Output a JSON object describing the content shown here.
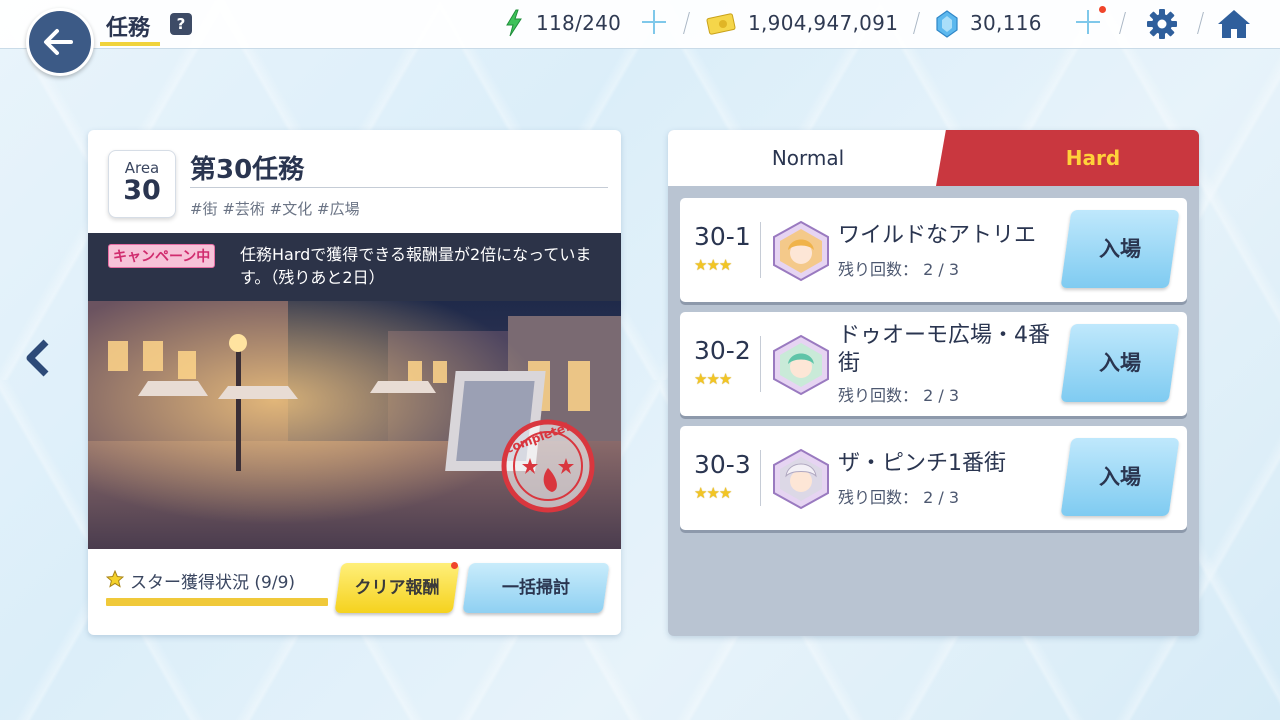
{
  "header": {
    "title": "任務",
    "help": "?",
    "stamina": "118/240",
    "money": "1,904,947,091",
    "gems": "30,116"
  },
  "mission": {
    "area_label": "Area",
    "area_number": "30",
    "title": "第30任務",
    "tags": "#街 #芸術 #文化 #広場",
    "campaign_badge": "キャンペーン中",
    "campaign_text": "任務Hardで獲得できる報酬量が2倍になっています。（残りあと2日）",
    "stamp_text": "complete!",
    "star_status": "スター獲得状況 (9/9)",
    "clear_reward_button": "クリア報酬",
    "sweep_button": "一括掃討"
  },
  "difficulty_tabs": {
    "normal": "Normal",
    "hard": "Hard",
    "selected": "Hard"
  },
  "stages": [
    {
      "id": "30-1",
      "stars": "★★★",
      "name": "ワイルドなアトリエ",
      "count": "残り回数： 2 / 3",
      "enter": "入場"
    },
    {
      "id": "30-2",
      "stars": "★★★",
      "name": "ドゥオーモ広場・4番街",
      "count": "残り回数： 2 / 3",
      "enter": "入場"
    },
    {
      "id": "30-3",
      "stars": "★★★",
      "name": "ザ・ピンチ1番街",
      "count": "残り回数： 2 / 3",
      "enter": "入場"
    }
  ],
  "colors": {
    "accent_yellow": "#f0d33c",
    "hard_red": "#c9373f",
    "navy": "#3c5a86"
  }
}
